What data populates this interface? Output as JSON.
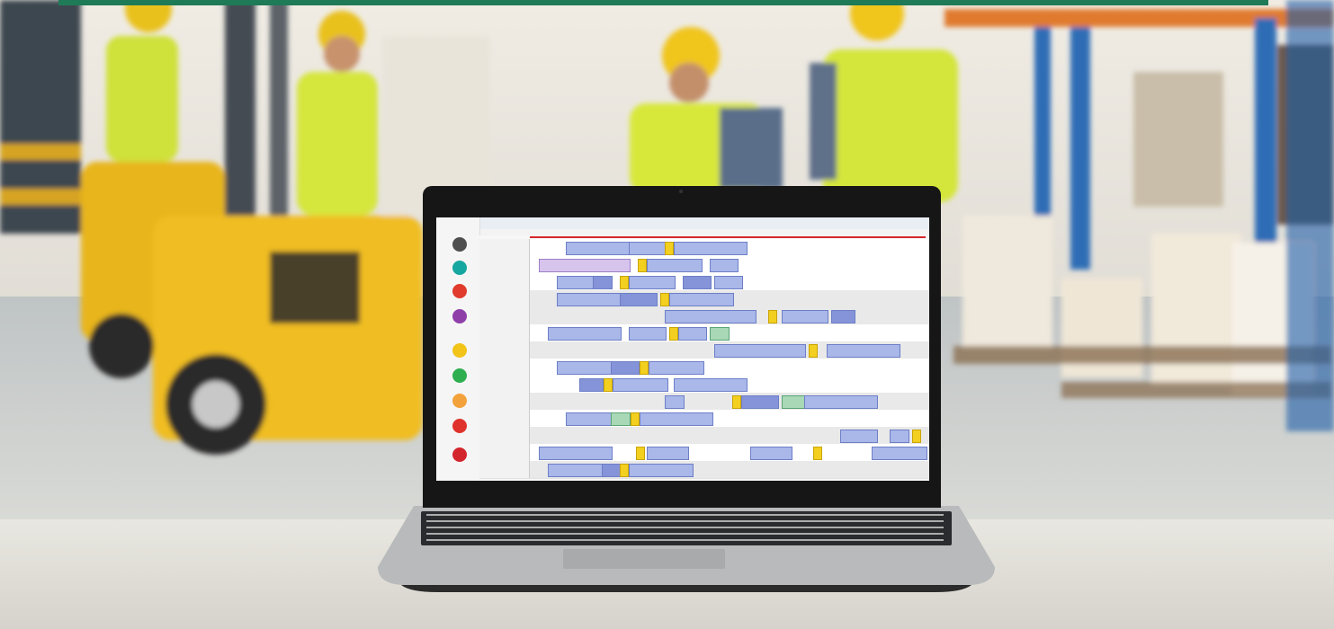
{
  "scene": {
    "description_visible_text": [],
    "colors": {
      "banner": "#1f7a57",
      "vest": "#d7e83a",
      "forklift": "#e8b51a",
      "rack_blue": "#2e6db5",
      "rack_orange": "#e07a2e",
      "gantt_block": "#a9b7e9",
      "gantt_highlight": "#f3cf1f",
      "time_marker": "#d7262d"
    }
  },
  "laptop_app": {
    "sidebar_icons": [
      {
        "name": "user-icon",
        "color": "#4f4f4f"
      },
      {
        "name": "send-icon",
        "color": "#16a7a0"
      },
      {
        "name": "truck-icon",
        "color": "#e03b2c"
      },
      {
        "name": "download-icon",
        "color": "#8e3fa8"
      },
      {
        "name": "box-icon",
        "color": "#f2c318"
      },
      {
        "name": "refresh-icon",
        "color": "#2eae4f"
      },
      {
        "name": "layers-icon",
        "color": "#f3a23b"
      },
      {
        "name": "alert-icon",
        "color": "#e0322d"
      },
      {
        "name": "delete-icon",
        "color": "#d3262c"
      }
    ]
  }
}
